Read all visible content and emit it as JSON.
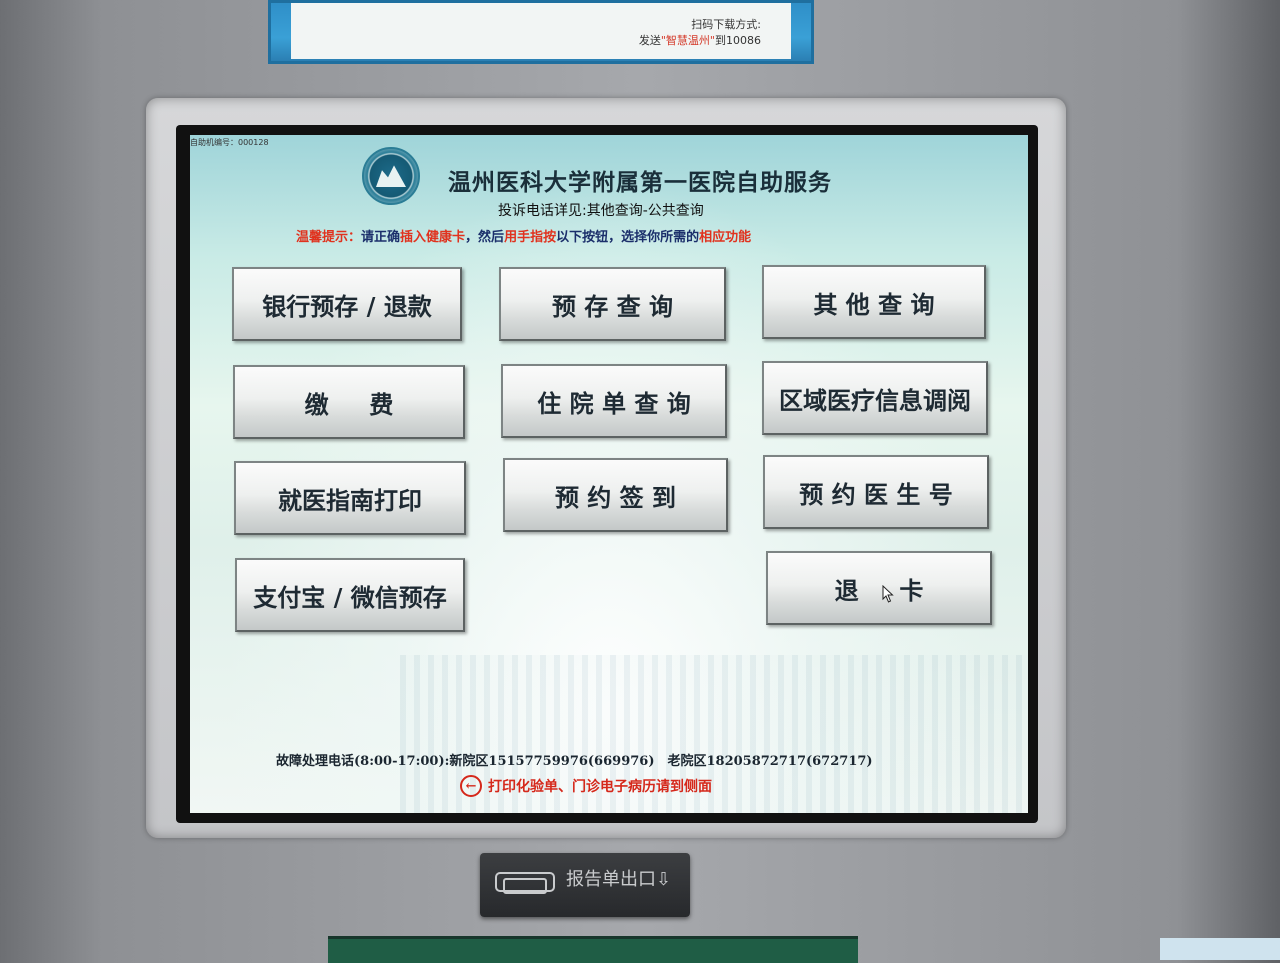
{
  "poster": {
    "line1": "扫码下载方式:",
    "line2_prefix": "发送",
    "line2_highlight": "\"智慧温州\"",
    "line2_suffix": "到10086"
  },
  "screen": {
    "device_id": "自助机编号：000128",
    "title": "温州医科大学附属第一医院自助服务",
    "subtitle": "投诉电话详见:其他查询-公共查询",
    "tip": {
      "p1": "温馨提示：",
      "p2": "请正确",
      "p3": "插入健康卡",
      "p4": "，然后",
      "p5": "用手指按",
      "p6": "以下按钮，选择你所需的",
      "p7": "相应功能"
    },
    "buttons": {
      "bank_deposit_refund": "银行预存 / 退款",
      "deposit_query": "预 存 查 询",
      "other_query": "其 他 查 询",
      "payment": "缴 　 费",
      "inpatient_query": "住 院 单 查 询",
      "regional_records": "区域医疗信息调阅",
      "guide_print": "就医指南打印",
      "appointment_checkin": "预 约 签 到",
      "book_doctor": "预 约 医 生 号",
      "alipay_wechat_deposit": "支付宝 / 微信预存",
      "return_card": "退 　 卡"
    },
    "footer": {
      "phone": "故障处理电话(8:00-17:00):新院区15157759976(669976)　老院区18205872717(672717)",
      "note": "打印化验单、门诊电子病历请到侧面"
    }
  },
  "kiosk": {
    "slot_label": "报告单出口"
  }
}
